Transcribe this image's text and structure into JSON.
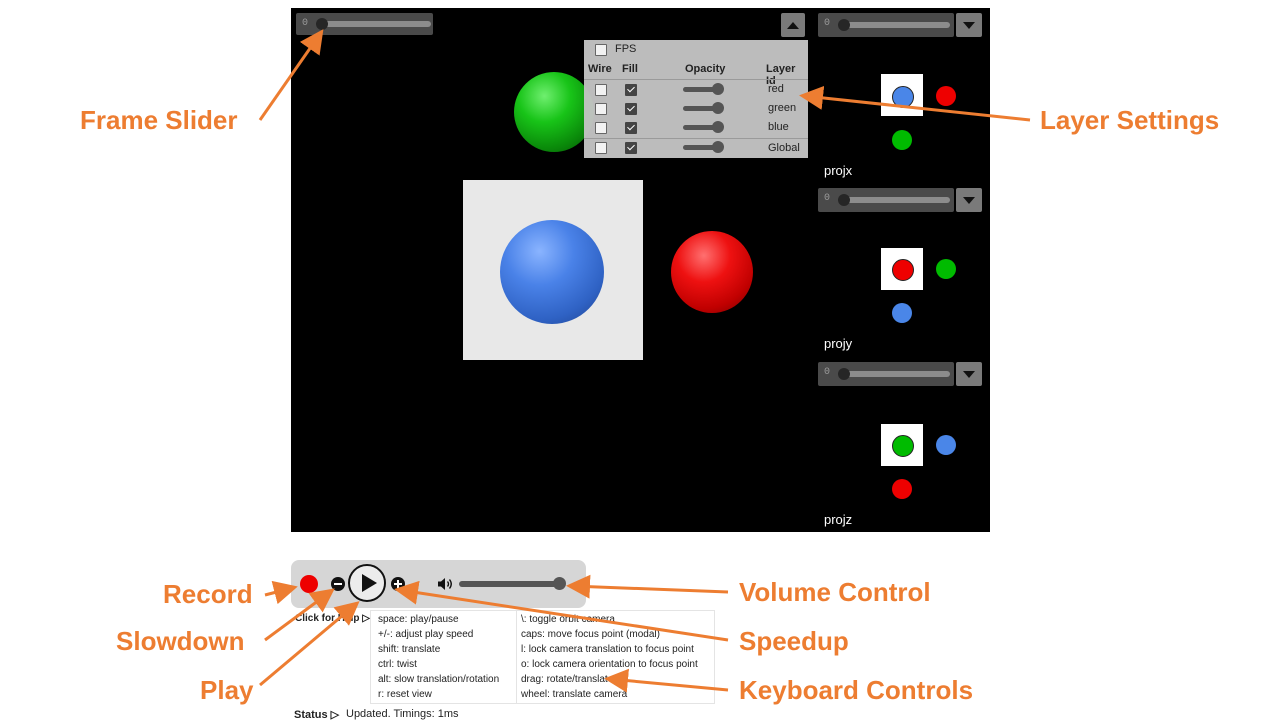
{
  "main_slider": {
    "value": "0"
  },
  "layer_panel": {
    "fps_label": "FPS",
    "headers": {
      "wire": "Wire",
      "fill": "Fill",
      "opacity": "Opacity",
      "layer_id": "Layer Id"
    },
    "rows": [
      {
        "id": "red",
        "wire": false,
        "fill": true,
        "opacity": 1.0
      },
      {
        "id": "green",
        "wire": false,
        "fill": true,
        "opacity": 1.0
      },
      {
        "id": "blue",
        "wire": false,
        "fill": true,
        "opacity": 1.0
      },
      {
        "id": "Global",
        "wire": false,
        "fill": true,
        "opacity": 1.0
      }
    ]
  },
  "projections": [
    {
      "label": "projx",
      "slider": "0"
    },
    {
      "label": "projy",
      "slider": "0"
    },
    {
      "label": "projz",
      "slider": "0"
    }
  ],
  "colors": {
    "red": "#ee0000",
    "green": "#00bb00",
    "blue": "#4a86e8",
    "callout": "#ed7d31"
  },
  "help": {
    "toggle": "Click for Help ▷",
    "left": [
      "space: play/pause",
      "+/-: adjust play speed",
      "shift: translate",
      "ctrl: twist",
      "alt: slow translation/rotation",
      "r: reset view"
    ],
    "right": [
      "\\: toggle orbit camera",
      "caps: move focus point (modal)",
      "l: lock camera translation to focus point",
      "o: lock camera orientation to focus point",
      "drag: rotate/translate",
      "wheel: translate camera"
    ]
  },
  "status": {
    "label": "Status ▷",
    "text": "Updated. Timings: 1ms"
  },
  "volume": {
    "level": 1.0
  },
  "callouts": {
    "frame_slider": "Frame Slider",
    "layer_settings": "Layer Settings",
    "record": "Record",
    "slowdown": "Slowdown",
    "play": "Play",
    "volume_control": "Volume Control",
    "speedup": "Speedup",
    "keyboard_controls": "Keyboard Controls"
  }
}
